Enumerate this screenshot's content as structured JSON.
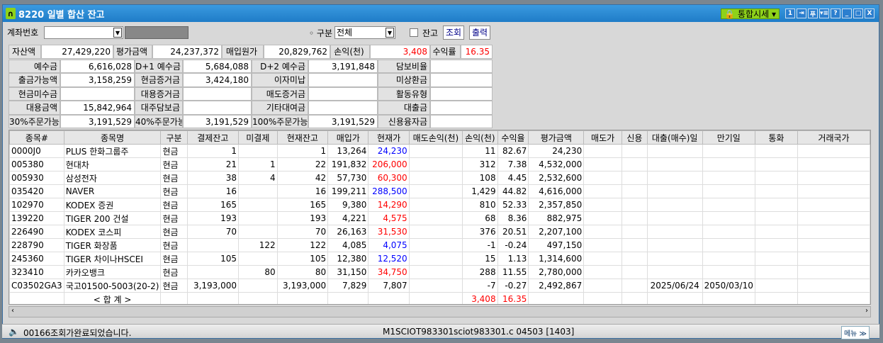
{
  "title": "8220 일별 합산 잔고",
  "titlebar": {
    "market_label": "통합시세",
    "buttons": [
      "1",
      "⇥",
      "푸",
      "▾≡",
      "?",
      "_",
      "□",
      "X"
    ]
  },
  "toolbar": {
    "account_label": "계좌번호",
    "account_value": "",
    "type_label": "구분",
    "type_value": "전체",
    "balance_check_label": "잔고",
    "query_button": "조회",
    "print_button": "출력"
  },
  "summary": {
    "asset_label": "자산액",
    "asset": "27,429,220",
    "eval_label": "평가금액",
    "eval": "24,237,372",
    "cost_label": "매입원가",
    "cost": "20,829,762",
    "pl_label": "손익(천)",
    "pl": "3,408",
    "rate_label": "수익률",
    "rate": "16.35"
  },
  "details": [
    [
      "예수금",
      "6,616,028",
      "D+1 예수금",
      "5,684,088",
      "D+2 예수금",
      "3,191,848",
      "담보비율",
      ""
    ],
    [
      "출금가능액",
      "3,158,259",
      "현금증거금",
      "3,424,180",
      "이자미납",
      "",
      "미상환금",
      ""
    ],
    [
      "현금미수금",
      "",
      "대용증거금",
      "",
      "매도증거금",
      "",
      "활동유형",
      ""
    ],
    [
      "대용금액",
      "15,842,964",
      "대주담보금",
      "",
      "기타대여금",
      "",
      "대출금",
      ""
    ],
    [
      "30%주문가능",
      "3,191,529",
      "40%주문가능",
      "3,191,529",
      "100%주문가능",
      "3,191,529",
      "신용융자금",
      ""
    ]
  ],
  "table": {
    "headers": [
      "종목#",
      "종목명",
      "구분",
      "결제잔고",
      "미결제",
      "현재잔고",
      "매입가",
      "현재가",
      "매도손익(천)",
      "손익(천)",
      "수익율",
      "평가금액",
      "매도가",
      "신용",
      "대출(매수)일",
      "만기일",
      "통화",
      "거래국가"
    ],
    "rows": [
      [
        "0000J0",
        "PLUS 한화그룹주",
        "현금",
        "1",
        "",
        "1",
        "13,264",
        "24,230",
        "",
        "11",
        "82.67",
        "24,230",
        "",
        "",
        "",
        "",
        "",
        ""
      ],
      [
        "005380",
        "현대차",
        "현금",
        "21",
        "1",
        "22",
        "191,832",
        "206,000",
        "",
        "312",
        "7.38",
        "4,532,000",
        "",
        "",
        "",
        "",
        "",
        ""
      ],
      [
        "005930",
        "삼성전자",
        "현금",
        "38",
        "4",
        "42",
        "57,730",
        "60,300",
        "",
        "108",
        "4.45",
        "2,532,600",
        "",
        "",
        "",
        "",
        "",
        ""
      ],
      [
        "035420",
        "NAVER",
        "현금",
        "16",
        "",
        "16",
        "199,211",
        "288,500",
        "",
        "1,429",
        "44.82",
        "4,616,000",
        "",
        "",
        "",
        "",
        "",
        ""
      ],
      [
        "102970",
        "KODEX 증권",
        "현금",
        "165",
        "",
        "165",
        "9,380",
        "14,290",
        "",
        "810",
        "52.33",
        "2,357,850",
        "",
        "",
        "",
        "",
        "",
        ""
      ],
      [
        "139220",
        "TIGER 200 건설",
        "현금",
        "193",
        "",
        "193",
        "4,221",
        "4,575",
        "",
        "68",
        "8.36",
        "882,975",
        "",
        "",
        "",
        "",
        "",
        ""
      ],
      [
        "226490",
        "KODEX 코스피",
        "현금",
        "70",
        "",
        "70",
        "26,163",
        "31,530",
        "",
        "376",
        "20.51",
        "2,207,100",
        "",
        "",
        "",
        "",
        "",
        ""
      ],
      [
        "228790",
        "TIGER 화장품",
        "현금",
        "",
        "122",
        "122",
        "4,085",
        "4,075",
        "",
        "-1",
        "-0.24",
        "497,150",
        "",
        "",
        "",
        "",
        "",
        ""
      ],
      [
        "245360",
        "TIGER 차이나HSCEI",
        "현금",
        "105",
        "",
        "105",
        "12,380",
        "12,520",
        "",
        "15",
        "1.13",
        "1,314,600",
        "",
        "",
        "",
        "",
        "",
        ""
      ],
      [
        "323410",
        "카카오뱅크",
        "현금",
        "",
        "80",
        "80",
        "31,150",
        "34,750",
        "",
        "288",
        "11.55",
        "2,780,000",
        "",
        "",
        "",
        "",
        "",
        ""
      ],
      [
        "C03502GA3",
        "국고01500-5003(20-2)",
        "현금",
        "3,193,000",
        "",
        "3,193,000",
        "7,829",
        "7,807",
        "",
        "-7",
        "-0.27",
        "2,492,867",
        "",
        "",
        "2025/06/24",
        "2050/03/10",
        "",
        ""
      ]
    ],
    "price_colors": [
      "blue",
      "red",
      "red",
      "blue",
      "red",
      "red",
      "red",
      "blue",
      "blue",
      "red",
      ""
    ],
    "total": {
      "label": "< 합    계 >",
      "pl": "3,408",
      "rate": "16.35"
    }
  },
  "status": {
    "message": "00166조회가완료되었습니다.",
    "screen_info": "M1SCIOT983301sciot983301.c   04503 [1403]",
    "menu_button": "메뉴 ≫"
  }
}
